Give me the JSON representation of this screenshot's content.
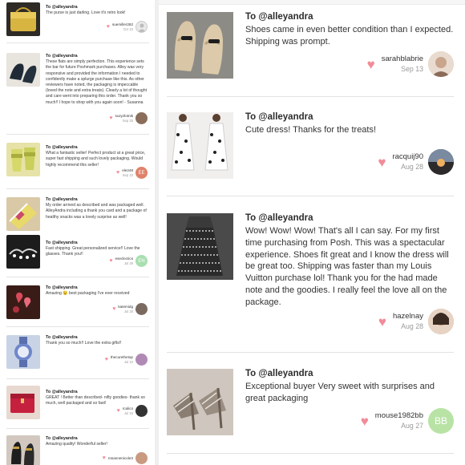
{
  "left_reviews": [
    {
      "to": "To @alleyandra",
      "text": "The purse is just darling. Love it's retro look!",
      "user": "suemiller282",
      "date": "Oct 10",
      "avatar": "",
      "avatar_color": "#e9e9e9",
      "thumb": "purse"
    },
    {
      "to": "To @alleyandra",
      "text": "These flats are simply perfection. This experience sets the bar for future Poshmark purchases. Alley was very responsive and provided the information I needed to confidently make a splurge purchase like this. As other reviewers have noted, the packaging is impeccable (loved the note and extra treats). Clearly a lot of thought and care went into preparing this order. Thank you so much!! I hope to shop with you again soon! - Susanna",
      "user": "suzyzlotnik",
      "date": "Sep 25",
      "avatar": "",
      "avatar_color": "#8a6d5a",
      "thumb": "flats"
    },
    {
      "to": "To @alleyandra",
      "text": "What a fantastic seller! Perfect product at a great price, super fast shipping and such lovely packaging. Would highly recommend this seller!",
      "user": "ele248",
      "date": "Sep 23",
      "avatar": "EE",
      "avatar_color": "#e0826a",
      "thumb": "slides"
    },
    {
      "to": "To @alleyandra",
      "text": "My order arrived as described and was packaged well. AlleyAndra including a thank you card and a package of healthy snacks was a lovely surprise as well!",
      "user": "",
      "date": "",
      "avatar": "",
      "avatar_color": "#ffffff",
      "thumb": "box"
    },
    {
      "to": "To @alleyandra",
      "text": "Fast shipping. Great personalized service!! Love the glasses. Thank you!!",
      "user": "eseclectics",
      "date": "Jul 29",
      "avatar": "EN",
      "avatar_color": "#a8dfb0",
      "thumb": "glasses"
    },
    {
      "to": "To @alleyandra",
      "text": "Amazing 😉 best packaging I've ever received",
      "user": "katemidg",
      "date": "Jul 28",
      "avatar": "",
      "avatar_color": "#7a6a60",
      "thumb": "hearts"
    },
    {
      "to": "To @alleyandra",
      "text": "Thank you so much!! Love the extra gifts!!",
      "user": "thecurethetop",
      "date": "Jul 10",
      "avatar": "",
      "avatar_color": "#b08ab5",
      "thumb": "watch"
    },
    {
      "to": "To @alleyandra",
      "text": "GREAT ! Better than described- nifty goodies- thank so much, well packaged and so fast!",
      "user": "rcalico",
      "date": "Jul 15",
      "avatar": "",
      "avatar_color": "#333333",
      "thumb": "bag"
    },
    {
      "to": "To @alleyandra",
      "text": "Amazing quality! Wonderful seller!",
      "user": "rosannenicole3",
      "date": "",
      "avatar": "",
      "avatar_color": "#c99a80",
      "thumb": "shoes"
    }
  ],
  "right_reviews": [
    {
      "to": "To @alleyandra",
      "text": "Shoes came in even better condition than I expected. Shipping was prompt.",
      "user": "sarahblabrie",
      "date": "Sep 13",
      "avatar": "",
      "avatar_color": "#d9c7b8",
      "thumb": "beige-flats"
    },
    {
      "to": "To @alleyandra",
      "text": "Cute dress! Thanks for the treats!",
      "user": "racquij90",
      "date": "Aug 28",
      "avatar": "",
      "avatar_color": "#5a4a40",
      "thumb": "dress"
    },
    {
      "to": "To @alleyandra",
      "text": "Wow! Wow! Wow! That's all I can say. For my first time purchasing from Posh. This was a spectacular experience. Shoes fit great and I know the dress will be great too. Shipping was faster than my Louis Vuitton purchase lol! Thank you for the had made note and the goodies. I really feel the love all on the package.",
      "user": "hazelnay",
      "date": "Aug 28",
      "avatar": "",
      "avatar_color": "#c9a58c",
      "thumb": "tweed"
    },
    {
      "to": "To @alleyandra",
      "text": "Exceptional buyer Very sweet with surprises and great packaging",
      "user": "mouse1982bb",
      "date": "Aug 27",
      "avatar": "BB",
      "avatar_color": "#b8e3a5",
      "thumb": "heels"
    }
  ],
  "colors": {
    "heart": "#f28b98",
    "divider": "#efefef"
  }
}
